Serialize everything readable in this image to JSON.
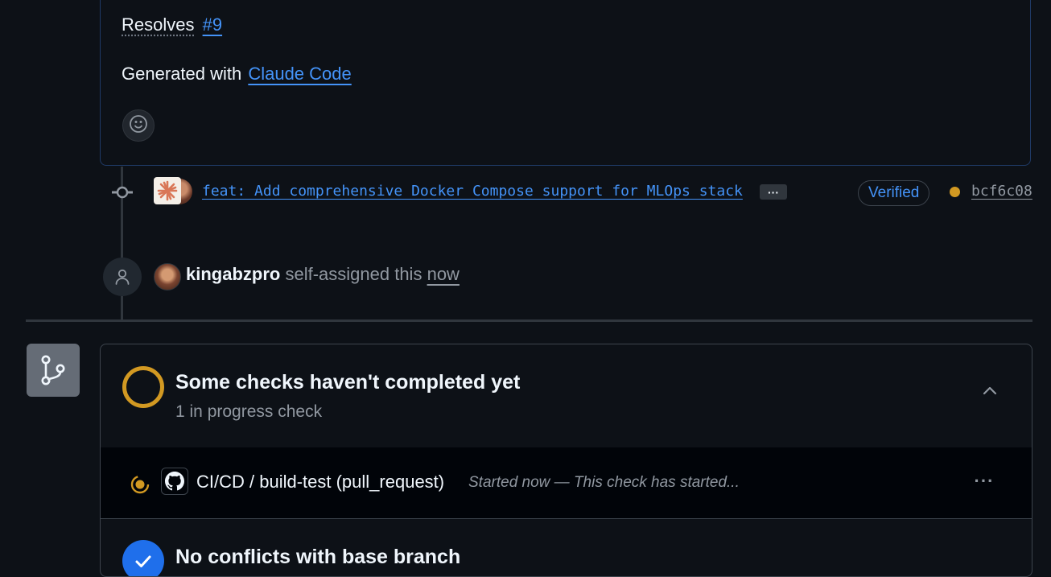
{
  "description": {
    "resolves_label": "Resolves",
    "resolves_issue": "#9",
    "generated_prefix": "Generated with",
    "generated_link": "Claude Code"
  },
  "commit": {
    "message": "feat: Add comprehensive Docker Compose support for MLOps stack",
    "more": "···",
    "verified_label": "Verified",
    "status_color": "#d29922",
    "sha": "bcf6c08"
  },
  "event": {
    "user": "kingabzpro",
    "action": "self-assigned this",
    "time": "now"
  },
  "checks": {
    "title": "Some checks haven't completed yet",
    "subtitle": "1 in progress check",
    "rows": [
      {
        "name": "CI/CD / build-test (pull_request)",
        "status": "Started now — This check has started...",
        "more": "···"
      }
    ]
  },
  "conflicts": {
    "title": "No conflicts with base branch"
  },
  "colors": {
    "link": "#4493f8",
    "pending": "#d29922",
    "success": "#1f6feb",
    "background": "#0d1117"
  }
}
